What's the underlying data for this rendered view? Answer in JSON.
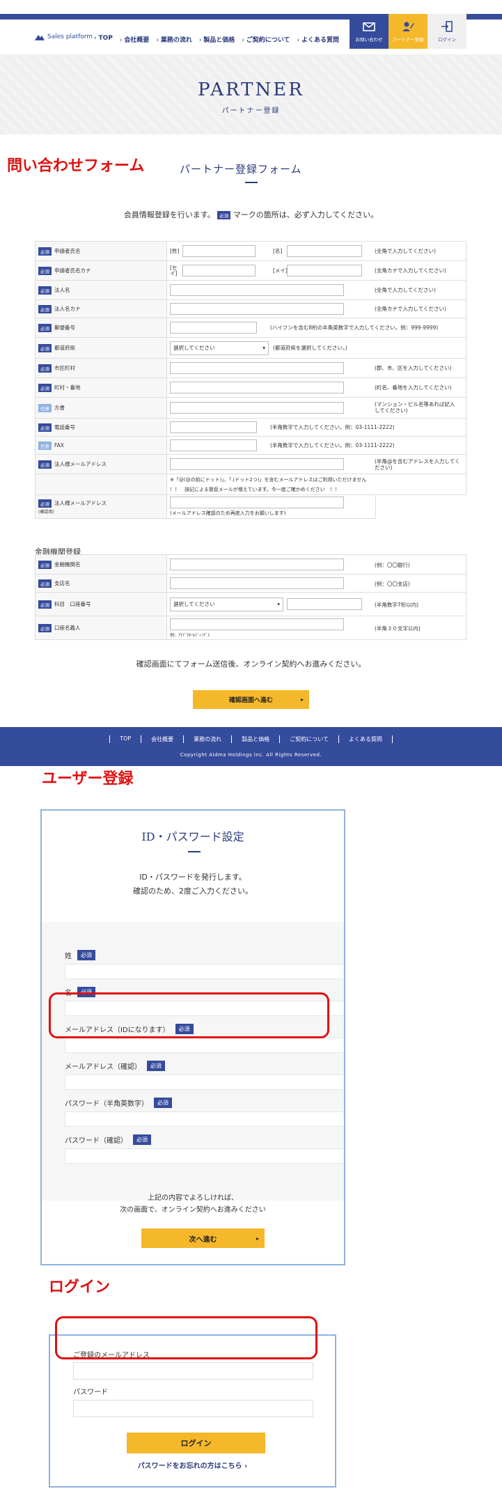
{
  "header": {
    "logo_text": "Sales platform",
    "nav": [
      "TOP",
      "会社概要",
      "業務の流れ",
      "製品と価格",
      "ご契約について",
      "よくある質問"
    ],
    "buttons": {
      "contact": "お問い合わせ",
      "partner": "パートナー登録",
      "login": "ログイン"
    }
  },
  "hero": {
    "title": "PARTNER",
    "subtitle": "パートナー登録"
  },
  "annotations": {
    "inquiry": "問い合わせフォーム",
    "user_register": "ユーザー登録",
    "login": "ログイン"
  },
  "form": {
    "title": "パートナー登録フォーム",
    "intro_before": "会員情報登録を行います。",
    "intro_after": "マークの箇所は、必ず入力してください。",
    "required_badge": "必須",
    "optional_badge": "任意",
    "rows": {
      "name": {
        "label": "申請者氏名",
        "sei": "[姓]",
        "mei": "[名]",
        "hint": "(全角で入力してください)"
      },
      "kana": {
        "label": "申請者氏名カナ",
        "sei": "[セイ]",
        "mei": "[メイ]",
        "hint": "(全角カナで入力してください)"
      },
      "corp": {
        "label": "法人名",
        "hint": "(全角で入力してください)"
      },
      "corp_kana": {
        "label": "法人名カナ",
        "hint": "(全角カナで入力してください)"
      },
      "zip": {
        "label": "郵便番号",
        "hint": "(ハイフンを含む8桁の半角英数字で入力してください。例：999-9999)"
      },
      "pref": {
        "label": "都道府県",
        "select": "選択してください",
        "hint": "(都道府県を選択してください。)"
      },
      "city": {
        "label": "市区町村",
        "hint": "(郡、市、区を入力してください)"
      },
      "town": {
        "label": "町村・番地",
        "hint": "(町名、番地を入力してください)"
      },
      "building": {
        "label": "方書",
        "hint": "(マンション・ビル名等あれば記入してください)"
      },
      "tel": {
        "label": "電話番号",
        "hint": "(半角数字で入力してください。例：03-1111-2222)"
      },
      "fax": {
        "label": "FAX",
        "hint": "(半角数字で入力してください。例：03-1111-2222)"
      },
      "email": {
        "label": "法人様メールアドレス",
        "hint": "(半角@を含むアドレスを入力してください)",
        "note1": "※「@(@の前にドット)」、「.(ドット2つ)」を含むメールアドレスはご利用いただけません",
        "note2": "！！　誤記による督促メールが増えています。今一度ご確かめください　！！"
      },
      "email_confirm": {
        "label": "法人様メールアドレス",
        "sub": "(確認用)",
        "hint": "(メールアドレス確認のため再度入力をお願いします)"
      }
    },
    "bank": {
      "title": "金融機関登録",
      "bank_name": {
        "label": "金融機関名",
        "hint": "(例：〇〇銀行)"
      },
      "branch": {
        "label": "支店名",
        "hint": "(例：〇〇支店)"
      },
      "account": {
        "label": "科目　口座番号",
        "select": "選択してください",
        "hint": "(半角数字7桁以内)"
      },
      "holder": {
        "label": "口座名義人",
        "example": "例：ｱｲﾄﾞﾏﾎｰﾙﾃﾞｨﾝｸﾞｽ",
        "hint": "(半角３０文字以内)"
      }
    },
    "confirm_text": "確認画面にてフォーム送信後、オンライン契約へお進みください。",
    "confirm_button": "確認画面へ進む"
  },
  "footer": {
    "nav": [
      "TOP",
      "会社概要",
      "業務の流れ",
      "製品と価格",
      "ご契約について",
      "よくある質問"
    ],
    "copyright": "Copyright Aidma Holdings Inc. All Rights Reserved."
  },
  "user_register": {
    "title": "ID・パスワード設定",
    "lead1": "ID・パスワードを発行します。",
    "lead2": "確認のため、2度ご入力ください。",
    "fields": [
      "姓",
      "名",
      "メールアドレス（IDになります）",
      "メールアドレス（確認）",
      "パスワード（半角英数字）",
      "パスワード（確認）"
    ],
    "required_badge": "必須",
    "note1": "上記の内容でよろしければ、",
    "note2": "次の画面で、オンライン契約へお進みください",
    "next_button": "次へ進む"
  },
  "login": {
    "email_label": "ご登録のメールアドレス",
    "password_label": "パスワード",
    "login_button": "ログイン",
    "forgot_link": "パスワードをお忘れの方はこちら"
  }
}
